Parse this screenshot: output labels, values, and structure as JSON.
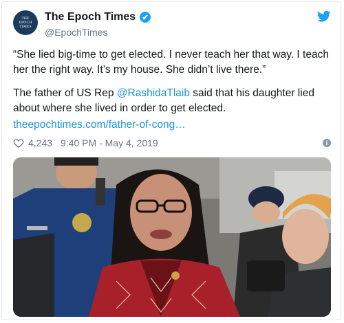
{
  "tweet": {
    "avatar_lines": [
      "THE",
      "EPOCH",
      "TIMES"
    ],
    "display_name": "The Epoch Times",
    "handle": "@EpochTimes",
    "quote": "“She lied big-time to get elected. I never teach her that way. I teach her the right way. It’s my house. She didn’t live there.”",
    "body_prefix": "The father of US Rep ",
    "mention": "@RashidaTlaib",
    "body_suffix": " said that his daughter lied about where she lived in order to get elected.",
    "link_text": "theepochtimes.com/father-of-cong…",
    "likes": "4,243",
    "timestamp": "9:40 PM - May 4, 2019",
    "info_glyph": "i",
    "verified_glyph": "✔"
  },
  "icons": {
    "verified": "verified-badge-icon",
    "twitter": "twitter-bird-icon",
    "like": "heart-icon",
    "info": "info-icon"
  },
  "colors": {
    "link": "#1b95e0",
    "verified": "#1da1f2",
    "muted": "#657786"
  },
  "media": {
    "type": "photo",
    "content": "Woman with glasses in embroidered red dress in a crowd, police officer behind"
  }
}
